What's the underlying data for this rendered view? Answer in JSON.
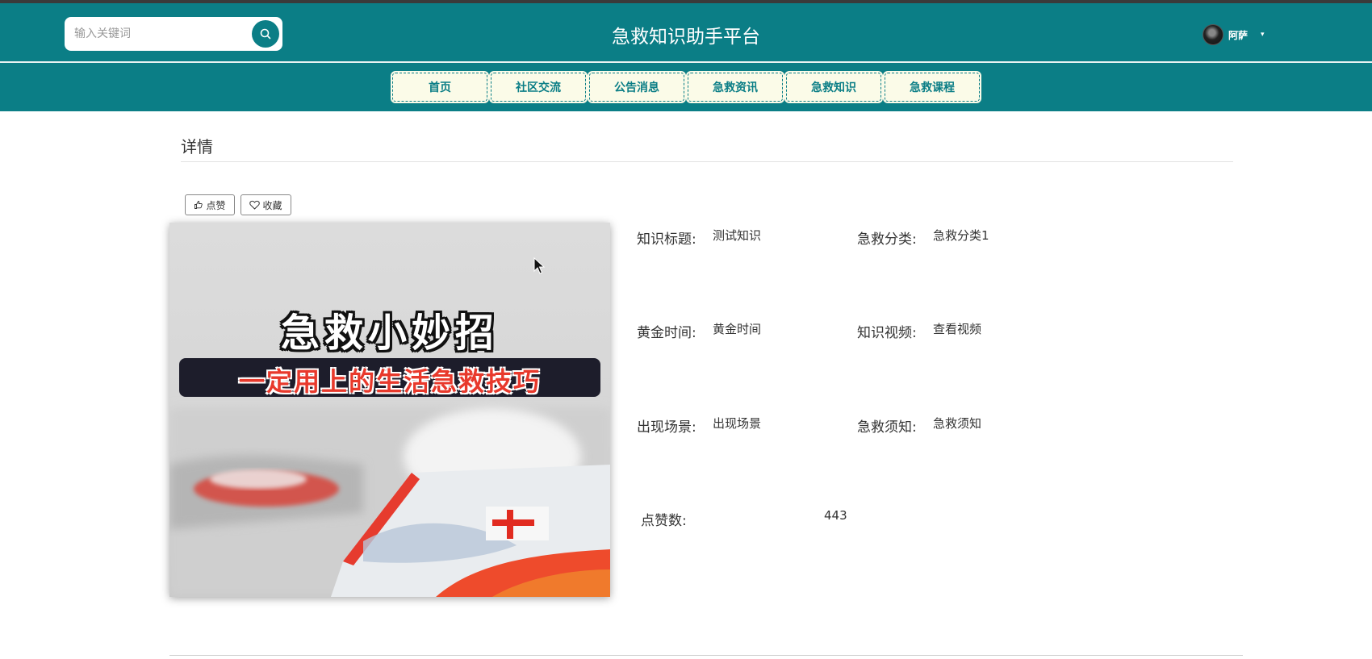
{
  "header": {
    "site_title": "急救知识助手平台",
    "search_placeholder": "输入关键词",
    "user_name": "阿萨",
    "caret": "▾"
  },
  "nav": [
    "首页",
    "社区交流",
    "公告消息",
    "急救资讯",
    "急救知识",
    "急救课程"
  ],
  "section": {
    "title": "详情"
  },
  "actions": {
    "like_label": "点赞",
    "favorite_label": "收藏"
  },
  "image": {
    "headline": "急救小妙招",
    "subheadline": "一定用上的生活急救技巧"
  },
  "details": {
    "title_label": "知识标题:",
    "title_value": "测试知识",
    "category_label": "急救分类:",
    "category_value": "急救分类1",
    "golden_time_label": "黄金时间:",
    "golden_time_value": "黄金时间",
    "video_label": "知识视频:",
    "video_value": "查看视频",
    "scene_label": "出现场景:",
    "scene_value": "出现场景",
    "notice_label": "急救须知:",
    "notice_value": "急救须知",
    "likes_label": "点赞数:",
    "likes_value": "443"
  },
  "colors": {
    "brand": "#0b7e86",
    "nav_bg": "#fbfbe8",
    "accent_red": "#e63b2e"
  }
}
